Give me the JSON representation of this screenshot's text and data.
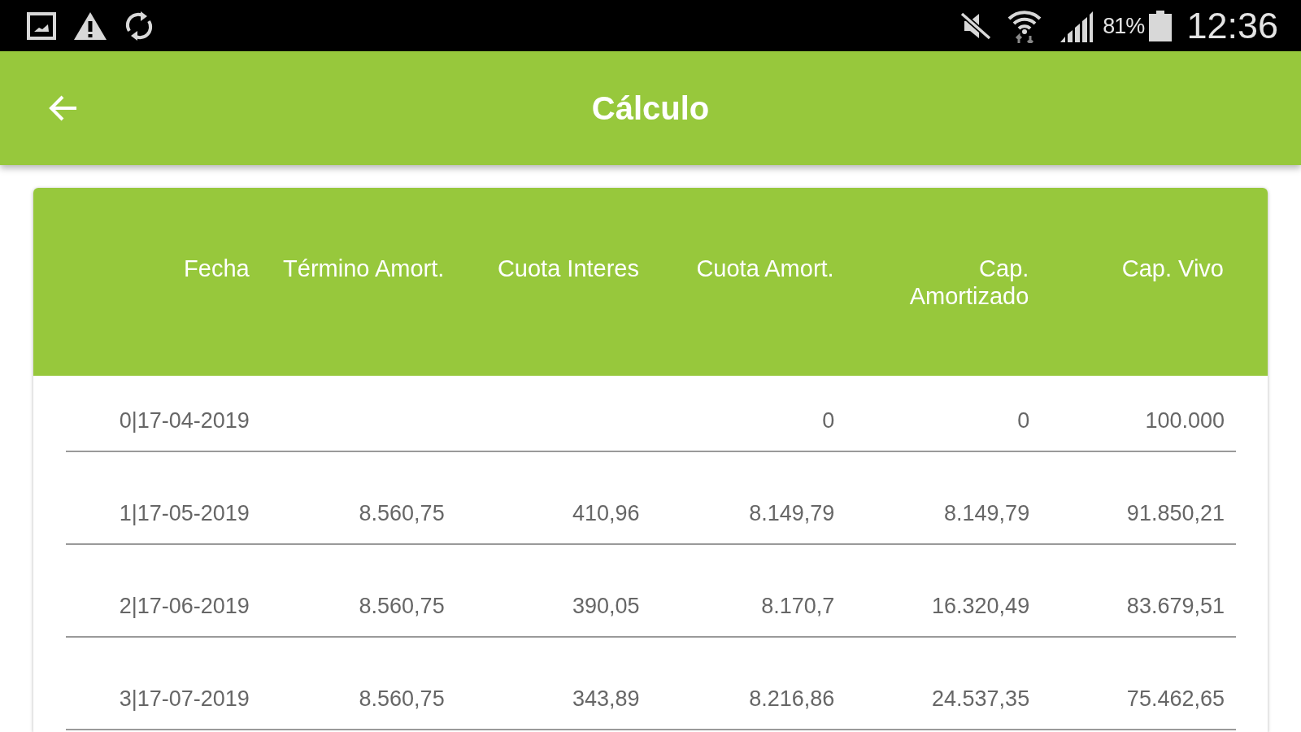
{
  "status_bar": {
    "battery": "81%",
    "time": "12:36"
  },
  "app_bar": {
    "title": "Cálculo"
  },
  "table": {
    "columns": [
      "Fecha",
      "Término Amort.",
      "Cuota Interes",
      "Cuota Amort.",
      "Cap. Amortizado",
      "Cap. Vivo"
    ],
    "rows": [
      [
        "0|17-04-2019",
        null,
        null,
        "0",
        "0",
        "100.000"
      ],
      [
        "1|17-05-2019",
        "8.560,75",
        "410,96",
        "8.149,79",
        "8.149,79",
        "91.850,21"
      ],
      [
        "2|17-06-2019",
        "8.560,75",
        "390,05",
        "8.170,7",
        "16.320,49",
        "83.679,51"
      ],
      [
        "3|17-07-2019",
        "8.560,75",
        "343,89",
        "8.216,86",
        "24.537,35",
        "75.462,65"
      ]
    ]
  }
}
